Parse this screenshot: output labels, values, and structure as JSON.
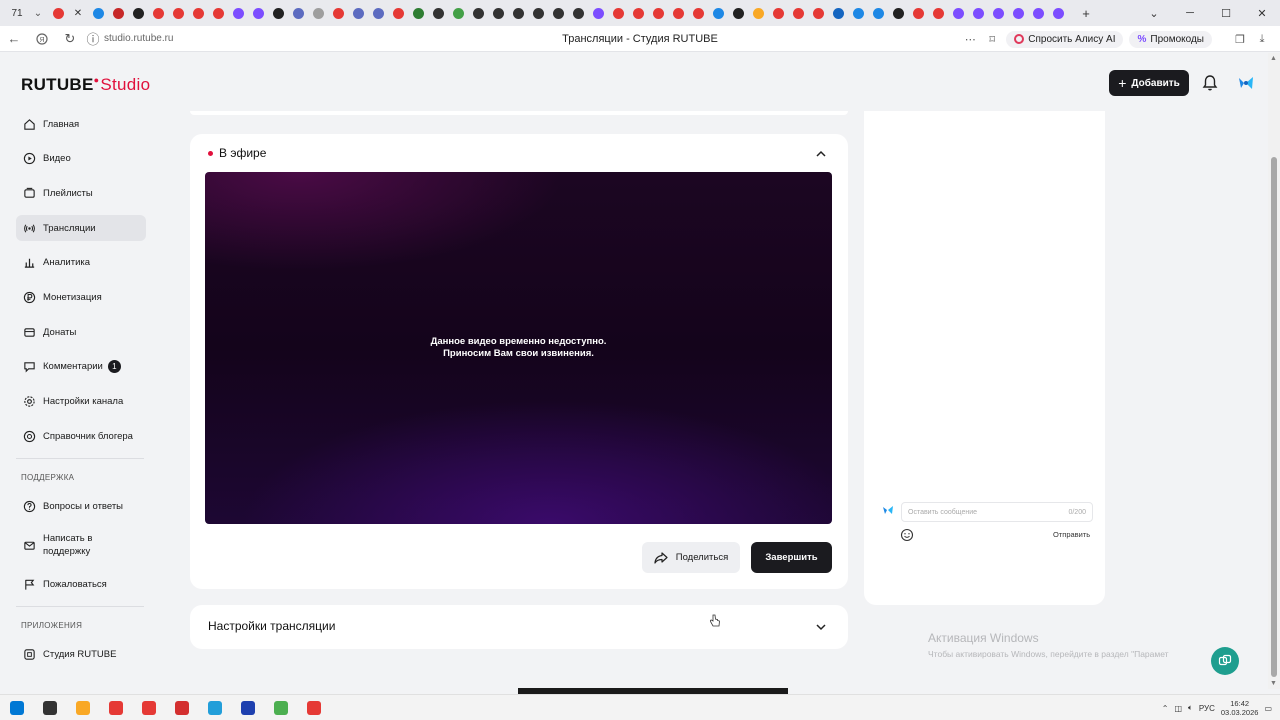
{
  "browser": {
    "tab_count": "71",
    "tab_favicon_colors": [
      "#e53935",
      "#1e88e5",
      "#c62828",
      "#222222",
      "#e53935",
      "#e53935",
      "#e53935",
      "#e53935",
      "#7c4dff",
      "#7c4dff",
      "#222222",
      "#5c6bc0",
      "#9e9e9e",
      "#e53935",
      "#5c6bc0",
      "#5c6bc0",
      "#e53935",
      "#2e7d32",
      "#333333",
      "#43a047",
      "#333333",
      "#333333",
      "#333333",
      "#333333",
      "#333333",
      "#333333",
      "#7c4dff",
      "#e53935",
      "#e53935",
      "#e53935",
      "#e53935",
      "#e53935",
      "#1e88e5",
      "#222222",
      "#f9a825",
      "#e53935",
      "#e53935",
      "#e53935",
      "#1565c0",
      "#1e88e5",
      "#1e88e5",
      "#222222",
      "#e53935",
      "#e53935",
      "#7c4dff",
      "#7c4dff",
      "#7c4dff",
      "#7c4dff",
      "#7c4dff",
      "#7c4dff"
    ],
    "url": "studio.rutube.ru",
    "page_title": "Трансляции - Студия RUTUBE",
    "alisa_label": "Спросить Алису AI",
    "promo_label": "Промокоды"
  },
  "header": {
    "logo_main": "RUTUBE",
    "logo_studio": "Studio",
    "add_label": "Добавить",
    "accent": "#e1103c"
  },
  "sidebar": {
    "items": [
      {
        "label": "Главная",
        "icon": "home-icon"
      },
      {
        "label": "Видео",
        "icon": "video-icon"
      },
      {
        "label": "Плейлисты",
        "icon": "playlist-icon"
      },
      {
        "label": "Трансляции",
        "icon": "broadcast-icon",
        "active": true
      },
      {
        "label": "Аналитика",
        "icon": "analytics-icon"
      },
      {
        "label": "Монетизация",
        "icon": "ruble-icon"
      },
      {
        "label": "Донаты",
        "icon": "donate-icon"
      },
      {
        "label": "Комментарии",
        "icon": "comment-icon",
        "badge": "1"
      },
      {
        "label": "Настройки канала",
        "icon": "gear-icon"
      },
      {
        "label": "Справочник блогера",
        "icon": "help-icon"
      }
    ],
    "support_heading": "ПОДДЕРЖКА",
    "support_items": [
      {
        "label": "Вопросы и ответы",
        "icon": "faq-icon"
      },
      {
        "label": "Написать в поддержку",
        "icon": "mail-icon"
      },
      {
        "label": "Пожаловаться",
        "icon": "flag-icon"
      }
    ],
    "apps_heading": "ПРИЛОЖЕНИЯ",
    "apps_items": [
      {
        "label": "Студия RUTUBE",
        "icon": "app-icon"
      }
    ]
  },
  "live": {
    "title": "В эфире",
    "player_line1": "Данное видео временно недоступно.",
    "player_line2": "Приносим Вам свои извинения.",
    "share_label": "Поделиться",
    "finish_label": "Завершить"
  },
  "settings": {
    "title": "Настройки трансляции"
  },
  "chat": {
    "placeholder": "Оставить сообщение",
    "counter": "0/200",
    "send_label": "Отправить"
  },
  "activation": {
    "line1": "Активация Windows",
    "line2": "Чтобы активировать Windows, перейдите в раздел \"Парамет"
  },
  "taskbar": {
    "icon_colors": [
      "#0078d4",
      "#333333",
      "#f9a825",
      "#e53935",
      "#e53935",
      "#d32f2f",
      "#229ed9",
      "#1e40af",
      "#4caf50",
      "#e53935"
    ],
    "lang": "РУС",
    "time": "16:42",
    "date": "03.03.2026"
  }
}
